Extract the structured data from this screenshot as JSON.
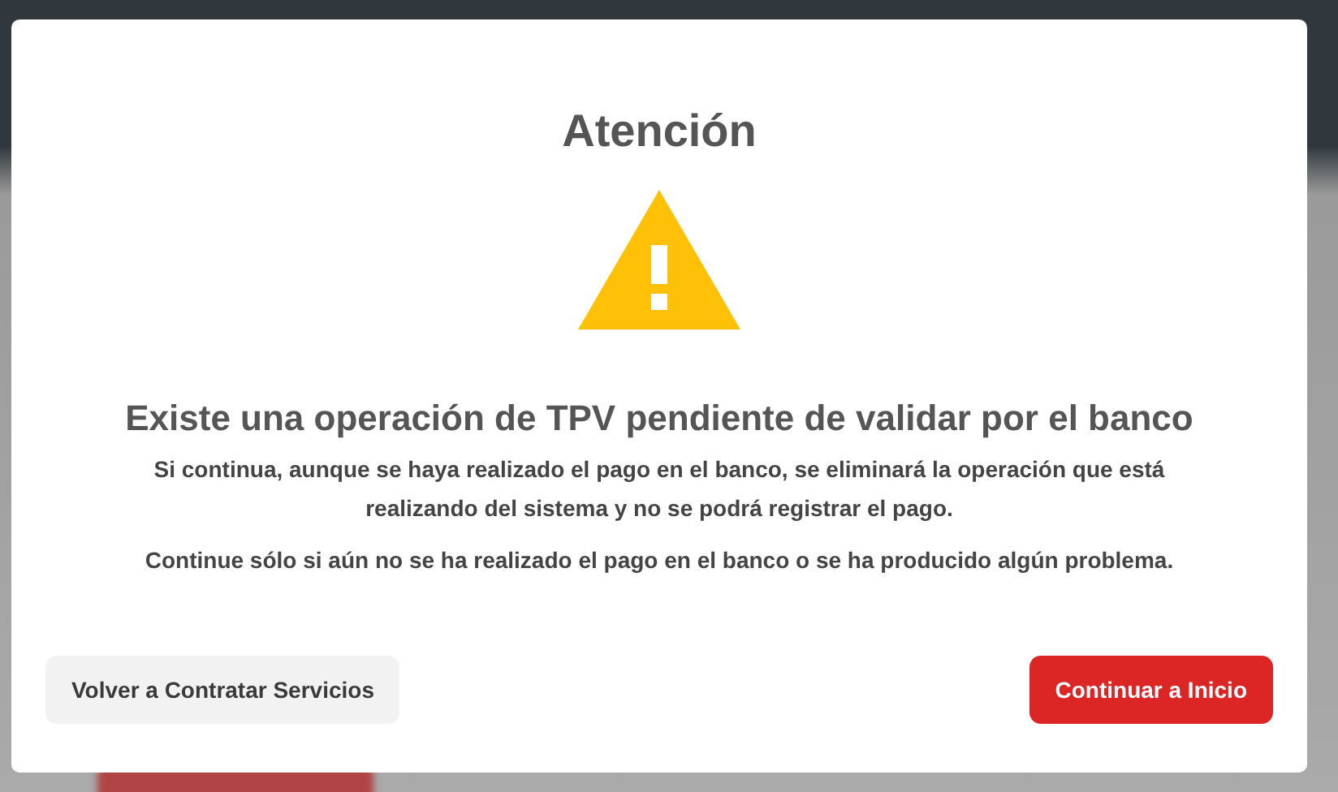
{
  "dialog": {
    "title": "Atención",
    "heading": "Existe una operación de TPV pendiente de validar por el banco",
    "paragraphs": [
      "Si continua, aunque se haya realizado el pago en el banco, se eliminará la operación que está realizando del sistema y no se podrá registrar el pago.",
      "Continue sólo si aún no se ha realizado el pago en el banco o se ha producido algún problema."
    ],
    "buttons": [
      {
        "label": "Volver a Contratar Servicios",
        "kind": "secondary"
      },
      {
        "label": "Continuar a Inicio",
        "kind": "primary"
      }
    ]
  }
}
